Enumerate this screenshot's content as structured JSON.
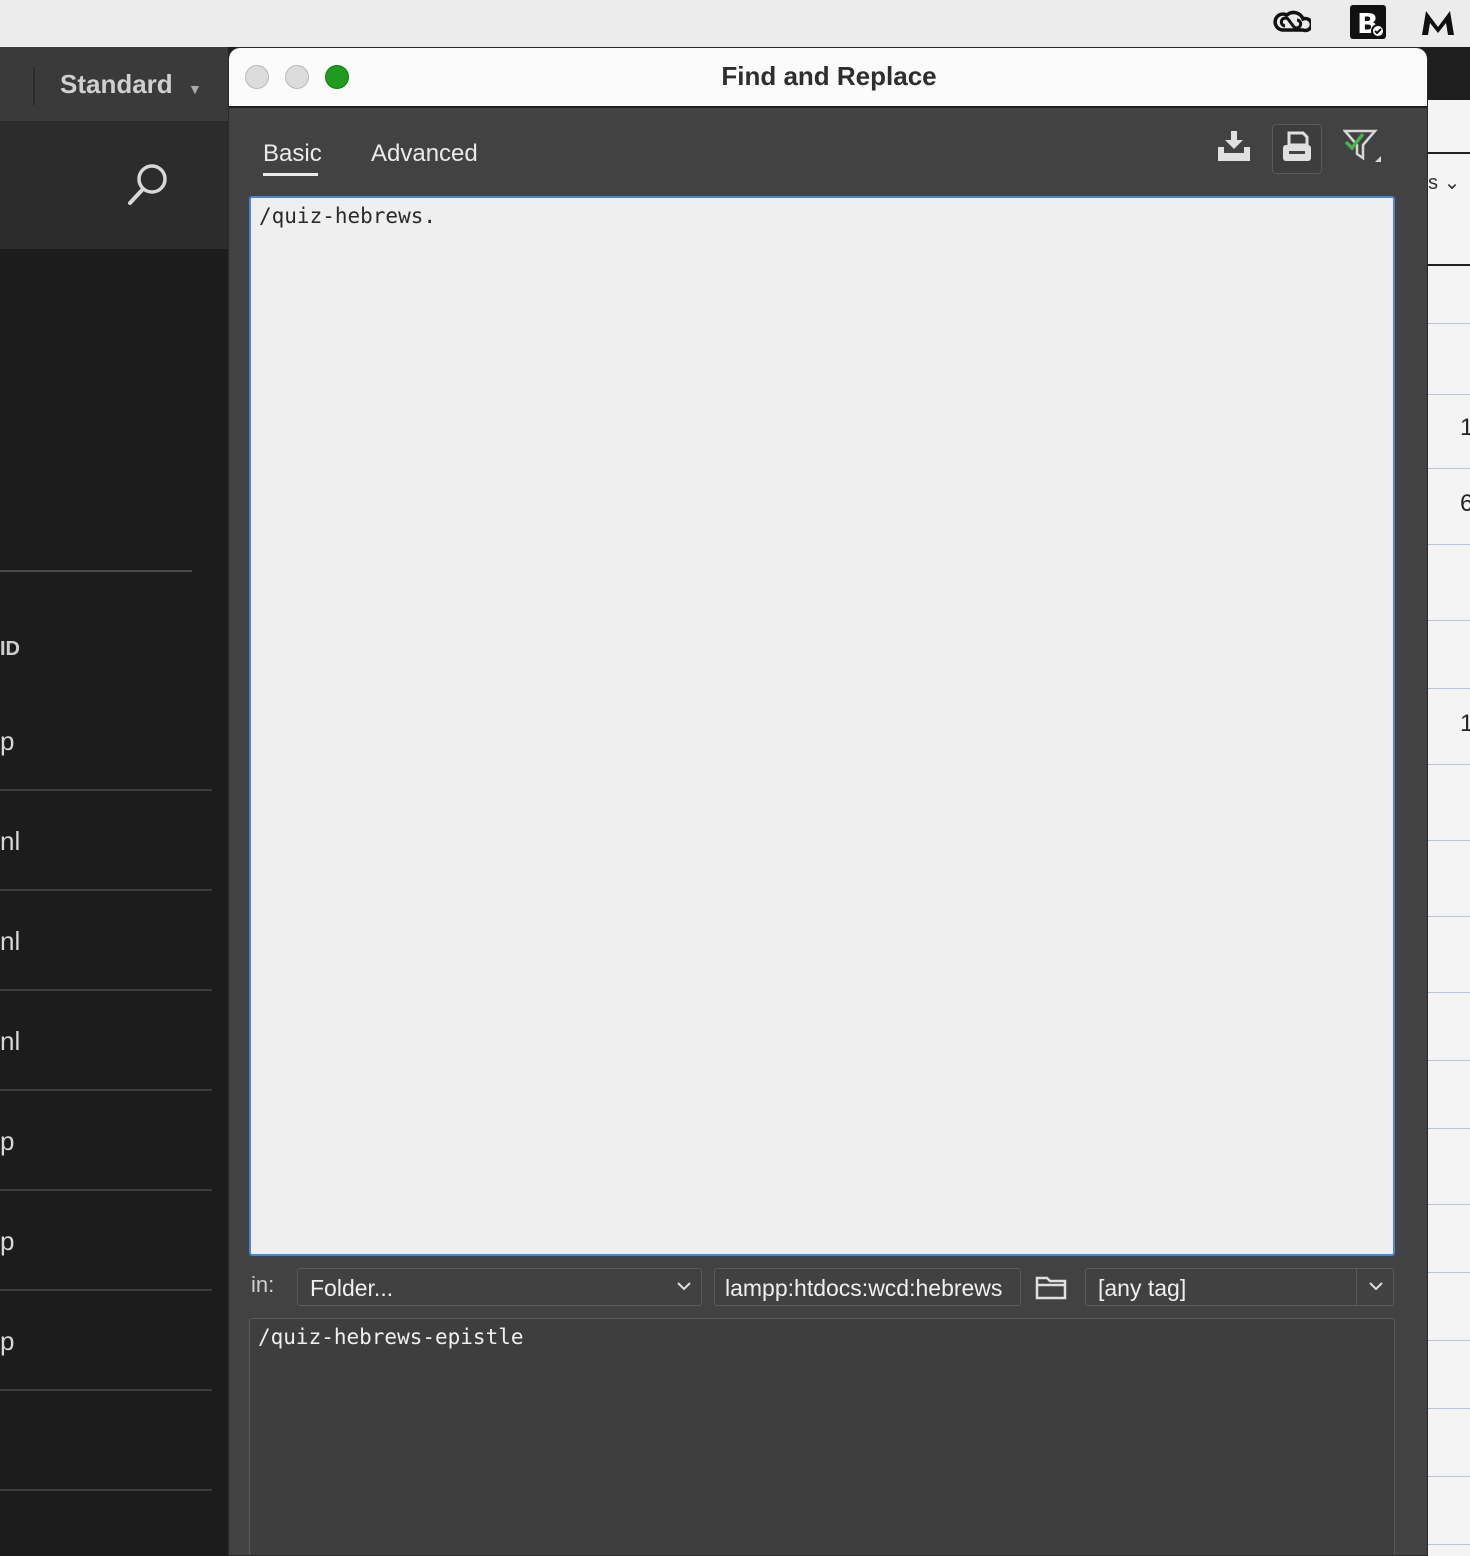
{
  "menubar": {
    "icons": [
      "creative-cloud-icon",
      "bbedit-icon",
      "malwarebytes-icon"
    ]
  },
  "app": {
    "workspace_label": "Standard",
    "left_header_label": "ID",
    "left_rows": [
      "p",
      "nl",
      "nl",
      "nl",
      "p",
      "p",
      "p",
      ""
    ],
    "right_numbers": [
      "1",
      "6",
      "1"
    ],
    "right_header_fragment": "s"
  },
  "dialog": {
    "title": "Find and Replace",
    "tabs": [
      {
        "label": "Basic",
        "active": true
      },
      {
        "label": "Advanced",
        "active": false
      }
    ],
    "toolbar": {
      "load_icon": "download-tray-icon",
      "save_icon": "save-query-icon",
      "filter_icon": "filter-check-icon"
    },
    "find_text": "/quiz-hebrews.",
    "in_label": "in:",
    "scope_value": "Folder...",
    "folder_path": "lampp:htdocs:wcd:hebrews",
    "tag_value": "[any tag]",
    "replace_text": "/quiz-hebrews-epistle"
  },
  "colors": {
    "focus_border": "#4a86d0",
    "traffic_green": "#1f9b1f",
    "filter_check": "#4caf50"
  }
}
